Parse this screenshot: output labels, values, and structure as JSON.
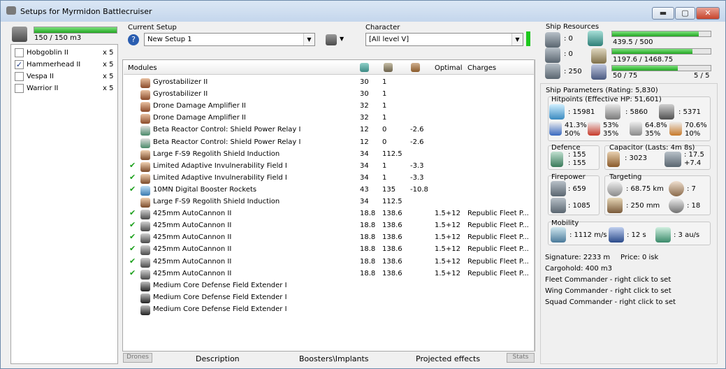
{
  "window": {
    "title": "Setups for Myrmidon Battlecruiser",
    "controls": {
      "minimize": "▬",
      "maximize": "▢",
      "close": "✕"
    }
  },
  "drone_bay": {
    "capacity": "150 / 150 m3",
    "fill": 1.0,
    "drones": [
      {
        "name": "Hobgoblin II",
        "qty": "x 5",
        "checked": false
      },
      {
        "name": "Hammerhead II",
        "qty": "x 5",
        "checked": true
      },
      {
        "name": "Vespa II",
        "qty": "x 5",
        "checked": false
      },
      {
        "name": "Warrior II",
        "qty": "x 5",
        "checked": false
      }
    ]
  },
  "setup": {
    "label": "Current Setup",
    "value": "New Setup 1"
  },
  "character": {
    "label": "Character",
    "value": "[All level V]"
  },
  "modules_table": {
    "headers": {
      "modules": "Modules",
      "optimal": "Optimal",
      "charges": "Charges"
    },
    "rows": [
      {
        "name": "Gyrostabilizer II",
        "c1": "30",
        "c2": "1",
        "c3": "",
        "opt": "",
        "charge": "",
        "active": false,
        "kind": "low"
      },
      {
        "name": "Gyrostabilizer II",
        "c1": "30",
        "c2": "1",
        "c3": "",
        "opt": "",
        "charge": "",
        "active": false,
        "kind": "low"
      },
      {
        "name": "Drone Damage Amplifier II",
        "c1": "32",
        "c2": "1",
        "c3": "",
        "opt": "",
        "charge": "",
        "active": false,
        "kind": "low"
      },
      {
        "name": "Drone Damage Amplifier II",
        "c1": "32",
        "c2": "1",
        "c3": "",
        "opt": "",
        "charge": "",
        "active": false,
        "kind": "low"
      },
      {
        "name": "Beta Reactor Control: Shield Power Relay I",
        "c1": "12",
        "c2": "0",
        "c3": "-2.6",
        "opt": "",
        "charge": "",
        "active": false,
        "kind": "rig"
      },
      {
        "name": "Beta Reactor Control: Shield Power Relay I",
        "c1": "12",
        "c2": "0",
        "c3": "-2.6",
        "opt": "",
        "charge": "",
        "active": false,
        "kind": "rig"
      },
      {
        "name": "Large F-S9 Regolith Shield Induction",
        "c1": "34",
        "c2": "112.5",
        "c3": "",
        "opt": "",
        "charge": "",
        "active": false,
        "kind": "mid"
      },
      {
        "name": "Limited Adaptive Invulnerability Field I",
        "c1": "34",
        "c2": "1",
        "c3": "-3.3",
        "opt": "",
        "charge": "",
        "active": true,
        "kind": "mid"
      },
      {
        "name": "Limited Adaptive Invulnerability Field I",
        "c1": "34",
        "c2": "1",
        "c3": "-3.3",
        "opt": "",
        "charge": "",
        "active": true,
        "kind": "mid"
      },
      {
        "name": "10MN Digital Booster Rockets",
        "c1": "43",
        "c2": "135",
        "c3": "-10.8",
        "opt": "",
        "charge": "",
        "active": true,
        "kind": "prop"
      },
      {
        "name": "Large F-S9 Regolith Shield Induction",
        "c1": "34",
        "c2": "112.5",
        "c3": "",
        "opt": "",
        "charge": "",
        "active": false,
        "kind": "mid"
      },
      {
        "name": "425mm AutoCannon II",
        "c1": "18.8",
        "c2": "138.6",
        "c3": "",
        "opt": "1.5+12",
        "charge": "Republic Fleet P...",
        "active": true,
        "kind": "gun"
      },
      {
        "name": "425mm AutoCannon II",
        "c1": "18.8",
        "c2": "138.6",
        "c3": "",
        "opt": "1.5+12",
        "charge": "Republic Fleet P...",
        "active": true,
        "kind": "gun"
      },
      {
        "name": "425mm AutoCannon II",
        "c1": "18.8",
        "c2": "138.6",
        "c3": "",
        "opt": "1.5+12",
        "charge": "Republic Fleet P...",
        "active": true,
        "kind": "gun"
      },
      {
        "name": "425mm AutoCannon II",
        "c1": "18.8",
        "c2": "138.6",
        "c3": "",
        "opt": "1.5+12",
        "charge": "Republic Fleet P...",
        "active": true,
        "kind": "gun"
      },
      {
        "name": "425mm AutoCannon II",
        "c1": "18.8",
        "c2": "138.6",
        "c3": "",
        "opt": "1.5+12",
        "charge": "Republic Fleet P...",
        "active": true,
        "kind": "gun"
      },
      {
        "name": "425mm AutoCannon II",
        "c1": "18.8",
        "c2": "138.6",
        "c3": "",
        "opt": "1.5+12",
        "charge": "Republic Fleet P...",
        "active": true,
        "kind": "gun"
      },
      {
        "name": "Medium Core Defense Field Extender I",
        "c1": "",
        "c2": "",
        "c3": "",
        "opt": "",
        "charge": "",
        "active": false,
        "kind": "rigd"
      },
      {
        "name": "Medium Core Defense Field Extender I",
        "c1": "",
        "c2": "",
        "c3": "",
        "opt": "",
        "charge": "",
        "active": false,
        "kind": "rigd"
      },
      {
        "name": "Medium Core Defense Field Extender I",
        "c1": "",
        "c2": "",
        "c3": "",
        "opt": "",
        "charge": "",
        "active": false,
        "kind": "rigd"
      }
    ]
  },
  "bottom_tabs": [
    "Drones",
    "Description",
    "Boosters\\Implants",
    "Projected effects",
    "Stats"
  ],
  "resources": {
    "title": "Ship Resources",
    "turret": ": 0",
    "launcher": ": 0",
    "drone_bw": ": 250",
    "cpu": {
      "text": "439.5 / 500",
      "fill": 0.879
    },
    "pg": {
      "text": "1197.6 / 1468.75",
      "fill": 0.815
    },
    "bandwidth": {
      "text": "50 / 75",
      "right": "5 / 5",
      "fill": 0.667
    }
  },
  "params": {
    "title": "Ship Parameters (Rating: 5,830)",
    "hp_title": "Hitpoints (Effective HP: 51,601)",
    "shield": ": 15981",
    "armor": ": 5860",
    "hull": ": 5371",
    "res": [
      [
        "41.3%",
        "50%"
      ],
      [
        "53%",
        "35%"
      ],
      [
        "64.8%",
        "35%"
      ],
      [
        "70.6%",
        "10%"
      ]
    ],
    "defence_title": "Defence",
    "def1": ": 155",
    "def2": ": 155",
    "cap_title": "Capacitor (Lasts: 4m 8s)",
    "cap": ": 3023",
    "cap_r1": ": 17.5",
    "cap_r2": "+7.4",
    "fire_title": "Firepower",
    "fire1": ": 659",
    "fire2": ": 1085",
    "target_title": "Targeting",
    "t_range": ": 68.75 km",
    "t_max": ": 7",
    "t_scan": ": 250 mm",
    "t_res": ": 18",
    "mob_title": "Mobility",
    "speed": ": 1112 m/s",
    "align": ": 12 s",
    "warp": ": 3 au/s",
    "signature": "Signature: 2233 m",
    "price": "Price: 0 isk",
    "cargo": "Cargohold: 400 m3",
    "fleet": "Fleet Commander - right click to set",
    "wing": "Wing Commander - right click to set",
    "squad": "Squad Commander - right click to set"
  }
}
